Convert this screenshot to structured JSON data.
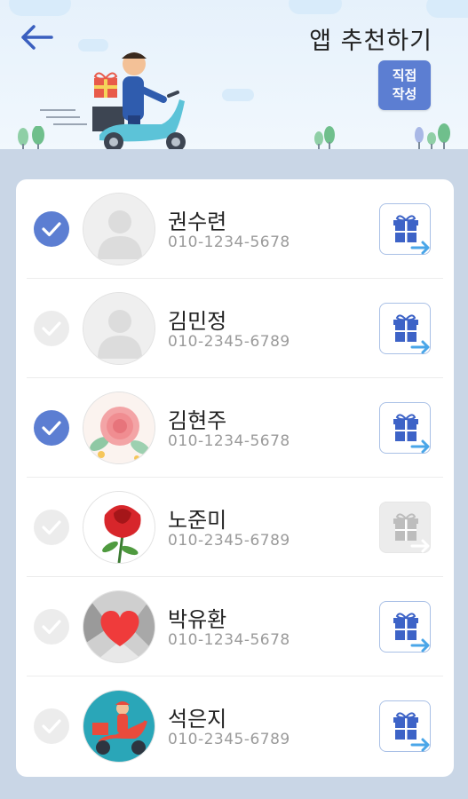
{
  "header": {
    "title": "앱 추천하기",
    "write_button": {
      "line1": "직접",
      "line2": "작성"
    },
    "back_icon": "arrow-left-icon"
  },
  "colors": {
    "accent": "#5c7ed2",
    "background": "#c9d6e6",
    "header_sky": "#e6f1fb",
    "gift_border": "#a9c0e6",
    "check_off": "#ececec"
  },
  "contacts": [
    {
      "name": "권수련",
      "phone": "010-1234-5678",
      "selected": true,
      "avatar": "default-person",
      "gift_enabled": true
    },
    {
      "name": "김민정",
      "phone": "010-2345-6789",
      "selected": false,
      "avatar": "default-person",
      "gift_enabled": true
    },
    {
      "name": "김현주",
      "phone": "010-1234-5678",
      "selected": true,
      "avatar": "rose-watercolor",
      "gift_enabled": true
    },
    {
      "name": "노준미",
      "phone": "010-2345-6789",
      "selected": false,
      "avatar": "red-rose",
      "gift_enabled": false
    },
    {
      "name": "박유환",
      "phone": "010-1234-5678",
      "selected": false,
      "avatar": "red-heart",
      "gift_enabled": true
    },
    {
      "name": "석은지",
      "phone": "010-2345-6789",
      "selected": false,
      "avatar": "delivery-scooter",
      "gift_enabled": true
    }
  ]
}
